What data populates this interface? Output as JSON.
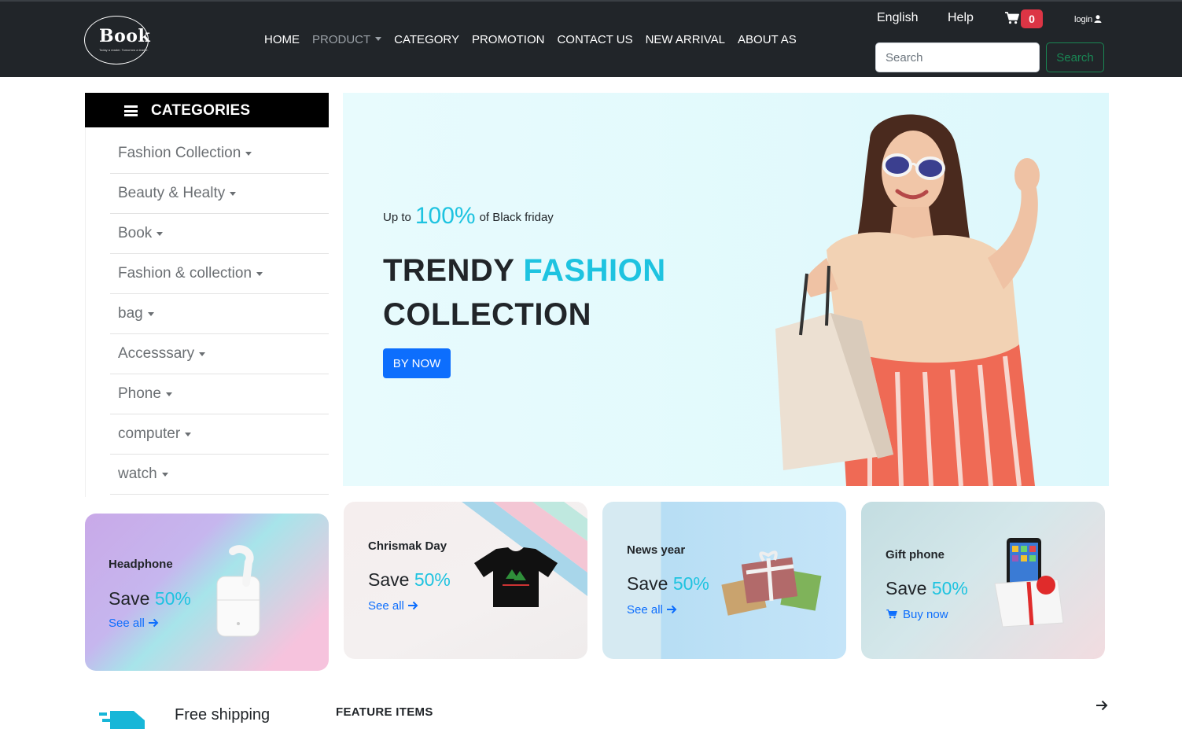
{
  "brand": {
    "name": "Book",
    "tagline": "Today a reader. Tomorrow a leader."
  },
  "nav": {
    "items": [
      {
        "label": "HOME"
      },
      {
        "label": "PRODUCT"
      },
      {
        "label": "CATEGORY"
      },
      {
        "label": "PROMOTION"
      },
      {
        "label": "CONTACT US"
      },
      {
        "label": "NEW ARRIVAL"
      },
      {
        "label": "ABOUT AS"
      }
    ],
    "language": "English",
    "help": "Help",
    "cart_count": "0",
    "login": "login",
    "search_placeholder": "Search",
    "search_button": "Search"
  },
  "sidebar": {
    "title": "CATEGORIES",
    "items": [
      {
        "label": "Fashion Collection"
      },
      {
        "label": "Beauty & Healty"
      },
      {
        "label": "Book"
      },
      {
        "label": "Fashion & collection"
      },
      {
        "label": "bag"
      },
      {
        "label": "Accesssary"
      },
      {
        "label": "Phone"
      },
      {
        "label": "computer"
      },
      {
        "label": "watch"
      }
    ]
  },
  "hero": {
    "prefix": "Up to",
    "highlight": "100%",
    "suffix": "of Black friday",
    "title_line1_a": "TRENDY",
    "title_line1_b": "FASHION",
    "title_line2": "COLLECTION",
    "button": "BY NOW"
  },
  "promos": [
    {
      "label": "Headphone",
      "save": "Save",
      "pct": "50%",
      "link": "See all"
    },
    {
      "label": "Chrismak Day",
      "save": "Save",
      "pct": "50%",
      "link": "See all"
    },
    {
      "label": "News year",
      "save": "Save",
      "pct": "50%",
      "link": "See all"
    },
    {
      "label": "Gift phone",
      "save": "Save",
      "pct": "50%",
      "link": "Buy now"
    }
  ],
  "features": {
    "shipping": "Free shipping",
    "section_title": "FEATURE ITEMS"
  },
  "colors": {
    "accent": "#1ec3e0",
    "primary": "#0d6efd",
    "success": "#198754",
    "danger": "#dc3545",
    "navbar": "#212529"
  }
}
